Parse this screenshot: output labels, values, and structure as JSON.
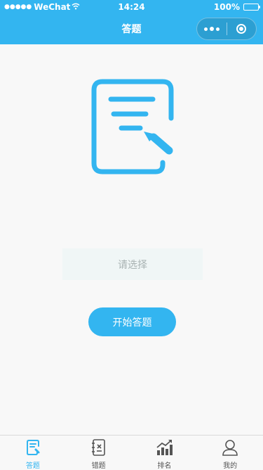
{
  "status_bar": {
    "carrier": "WeChat",
    "time": "14:24",
    "battery": "100%"
  },
  "nav": {
    "title": "答题"
  },
  "main": {
    "picker_placeholder": "请选择",
    "start_button_label": "开始答题"
  },
  "tabbar": {
    "items": [
      {
        "label": "答题",
        "icon": "answer-document-icon",
        "active": true
      },
      {
        "label": "错题",
        "icon": "wrong-notebook-icon",
        "active": false
      },
      {
        "label": "排名",
        "icon": "ranking-chart-icon",
        "active": false
      },
      {
        "label": "我的",
        "icon": "profile-user-icon",
        "active": false
      }
    ]
  },
  "colors": {
    "accent": "#33b5f0",
    "tab_inactive": "#555555"
  }
}
